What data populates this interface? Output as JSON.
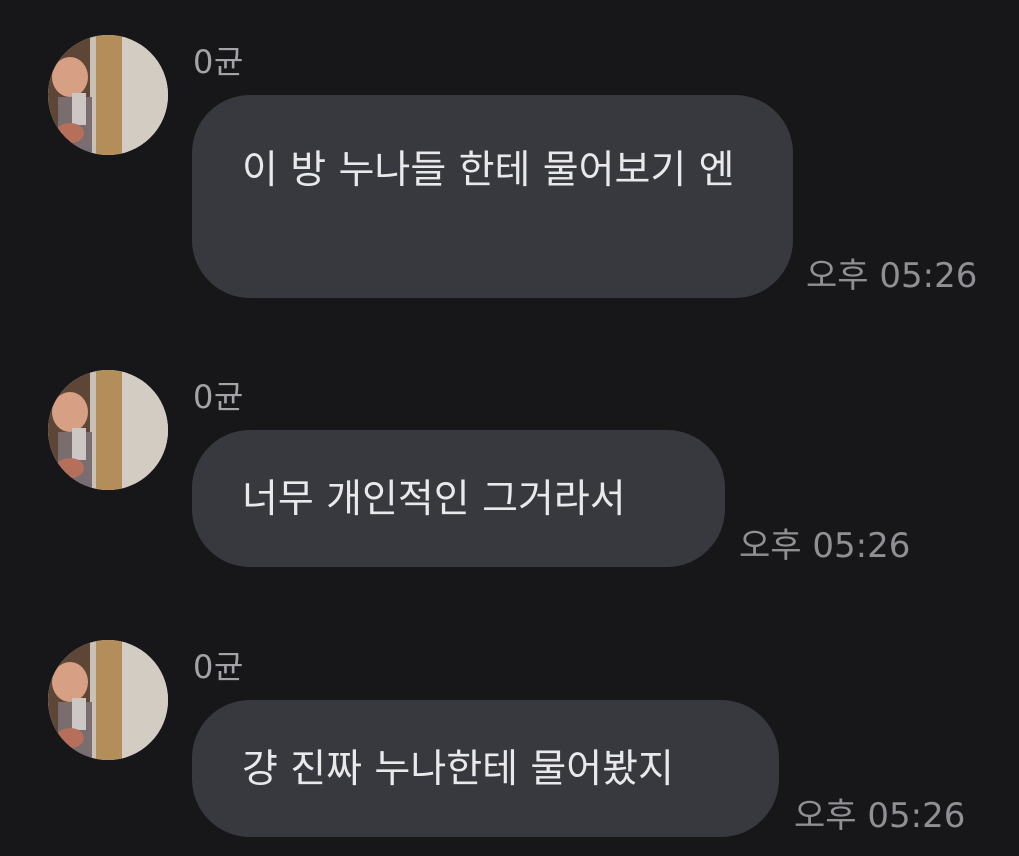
{
  "messages": [
    {
      "sender": "0균",
      "text": "이 방 누나들 한테 물어보기 엔",
      "time": "오후 05:26"
    },
    {
      "sender": "0균",
      "text": "너무 개인적인 그거라서",
      "time": "오후 05:26"
    },
    {
      "sender": "0균",
      "text": "걍 진짜 누나한테 물어봤지",
      "time": "오후 05:26"
    }
  ],
  "colors": {
    "background": "#17171a",
    "bubble": "#38393e",
    "bubble_text": "#e9e9ec",
    "sender": "#a3a3a8",
    "time": "#8f8f94"
  },
  "icons": {
    "avatar": "profile-photo-avatar"
  }
}
